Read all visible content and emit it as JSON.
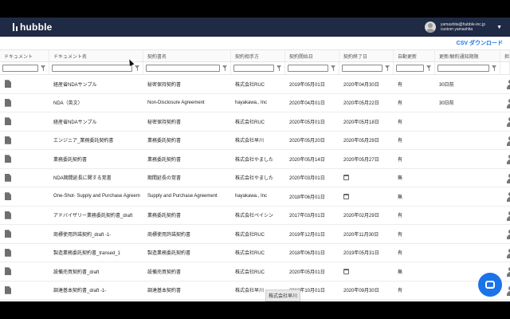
{
  "app": {
    "logo_text": "hubble"
  },
  "user": {
    "email": "yamashita@hubble-inc.jp",
    "name": "custom yamashita"
  },
  "toolbar": {
    "csv_label": "CSV ダウンロード"
  },
  "table": {
    "columns": [
      "ドキュメント",
      "ドキュメント名",
      "契約書名",
      "契約相手方",
      "契約開始日",
      "契約終了日",
      "自動更新",
      "更新/解約通知期限",
      "担"
    ],
    "rows": [
      {
        "doc_name": "経産省NDAサンプル",
        "contract_name": "秘密保持契約書",
        "party": "株式会社RUC",
        "start": "2019年05月01日",
        "end": "2020年04月30日",
        "auto": "有",
        "notice": "30日前",
        "end_icon": false
      },
      {
        "doc_name": "NDA（英文）",
        "contract_name": "Non-Disclosure Agreement",
        "party": "hayakawa., Inc",
        "start": "2020年04月01日",
        "end": "2020年05月22日",
        "auto": "有",
        "notice": "30日前",
        "end_icon": false
      },
      {
        "doc_name": "経産省NDAサンプル",
        "contract_name": "秘密保持契約書",
        "party": "株式会社RUC",
        "start": "2020年05月01日",
        "end": "2020年05月18日",
        "auto": "有",
        "notice": "",
        "end_icon": false
      },
      {
        "doc_name": "エンジニア_業務委託契約書",
        "contract_name": "業務委託契約書",
        "party": "株式会社早川",
        "start": "2020年05月20日",
        "end": "2020年05月29日",
        "auto": "有",
        "notice": "",
        "end_icon": false
      },
      {
        "doc_name": "業務委託契約書",
        "contract_name": "業務委託契約書",
        "party": "株式会社やました",
        "start": "2020年05月14日",
        "end": "2020年05月27日",
        "auto": "有",
        "notice": "",
        "end_icon": false
      },
      {
        "doc_name": "NDA期間延長に関する覚書",
        "contract_name": "期間延長の覚書",
        "party": "株式会社やました",
        "start": "2020年03月01日",
        "end": "",
        "auto": "無",
        "notice": "",
        "end_icon": true
      },
      {
        "doc_name": "One-Shot- Supply and Purchase Agreem",
        "contract_name": "Supply and Purchase Agreement",
        "party": "hayakawa., Inc",
        "start": "2018年06月01日",
        "end": "",
        "auto": "無",
        "notice": "",
        "end_icon": true
      },
      {
        "doc_name": "アドバイザリー業務委託契約書_draft",
        "contract_name": "業務委託契約書",
        "party": "株式会社ペイシン",
        "start": "2017年03月01日",
        "end": "2020年02月29日",
        "auto": "有",
        "notice": "",
        "end_icon": false
      },
      {
        "doc_name": "商標使用許諾契約_draft -1-",
        "contract_name": "商標使用許諾契約書",
        "party": "株式会社RUC",
        "start": "2019年12月01日",
        "end": "2020年11月30日",
        "auto": "有",
        "notice": "",
        "end_icon": false
      },
      {
        "doc_name": "製造業務委託契約書_transed_1",
        "contract_name": "製造業務委託契約書",
        "party": "株式会社RUC",
        "start": "2018年06月01日",
        "end": "2019年05月31日",
        "auto": "有",
        "notice": "",
        "end_icon": false
      },
      {
        "doc_name": "設備売買契約書_draft",
        "contract_name": "設備売買契約書",
        "party": "株式会社RUC",
        "start": "2020年05月01日",
        "end": "",
        "auto": "無",
        "notice": "",
        "end_icon": true
      },
      {
        "doc_name": "調達基本契約書_draft -1-",
        "contract_name": "調達基本契約書",
        "party": "株式会社早川",
        "start": "2018年10月01日",
        "end": "2020年09月30日",
        "auto": "有",
        "notice": "",
        "end_icon": false
      }
    ]
  },
  "tooltip": {
    "text": "株式会社早川"
  }
}
